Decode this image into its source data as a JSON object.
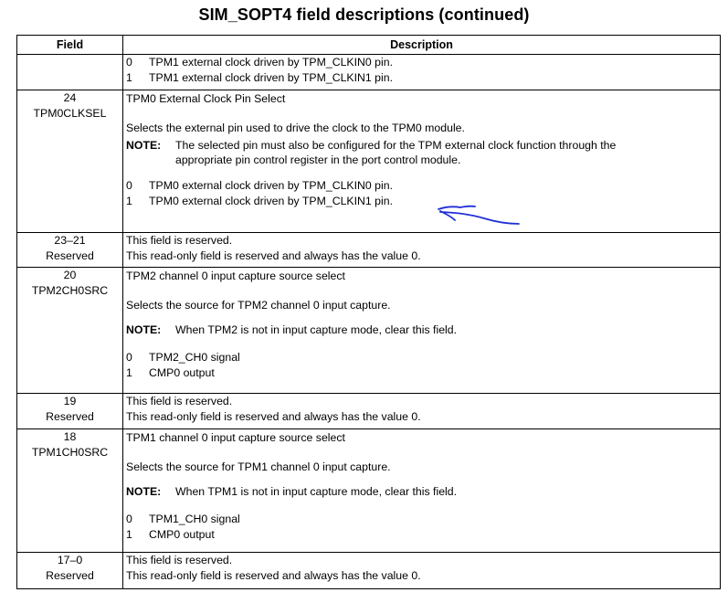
{
  "title": "SIM_SOPT4 field descriptions (continued)",
  "headers": {
    "field": "Field",
    "description": "Description"
  },
  "rows": [
    {
      "bits": "",
      "name": "",
      "values": [
        {
          "code": "0",
          "text": "TPM1 external clock driven by TPM_CLKIN0 pin."
        },
        {
          "code": "1",
          "text": "TPM1 external clock driven by TPM_CLKIN1 pin."
        }
      ]
    },
    {
      "bits": "24",
      "name": "TPM0CLKSEL",
      "heading": "TPM0 External Clock Pin Select",
      "para": "Selects the external pin used to drive the clock to the TPM0 module.",
      "note_label": "NOTE:",
      "note_line1": "The selected pin must also be configured for the TPM external clock function through the",
      "note_line2": "appropriate pin control register in the port control module.",
      "values": [
        {
          "code": "0",
          "text": "TPM0 external clock driven by TPM_CLKIN0 pin."
        },
        {
          "code": "1",
          "text": "TPM0 external clock driven by TPM_CLKIN1 pin."
        }
      ]
    },
    {
      "bits": "23–21",
      "name": "Reserved",
      "line1": "This field is reserved.",
      "line2": "This read-only field is reserved and always has the value 0."
    },
    {
      "bits": "20",
      "name": "TPM2CH0SRC",
      "heading": "TPM2 channel 0 input capture source select",
      "para": "Selects the source for TPM2 channel 0 input capture.",
      "note_label": "NOTE:",
      "note_text": "When TPM2 is not in input capture mode, clear this field.",
      "values": [
        {
          "code": "0",
          "text": "TPM2_CH0 signal"
        },
        {
          "code": "1",
          "text": "CMP0 output"
        }
      ]
    },
    {
      "bits": "19",
      "name": "Reserved",
      "line1": "This field is reserved.",
      "line2": "This read-only field is reserved and always has the value 0."
    },
    {
      "bits": "18",
      "name": "TPM1CH0SRC",
      "heading": "TPM1 channel 0 input capture source select",
      "para": "Selects the source for TPM1 channel 0 input capture.",
      "note_label": "NOTE:",
      "note_text": "When TPM1 is not in input capture mode, clear this field.",
      "values": [
        {
          "code": "0",
          "text": "TPM1_CH0 signal"
        },
        {
          "code": "1",
          "text": "CMP0 output"
        }
      ]
    },
    {
      "bits": "17–0",
      "name": "Reserved",
      "line1": "This field is reserved.",
      "line2": "This read-only field is reserved and always has the value 0."
    }
  ],
  "annotation": {
    "color": "#1f2fd6",
    "icon": "handwritten-arrow-icon"
  }
}
